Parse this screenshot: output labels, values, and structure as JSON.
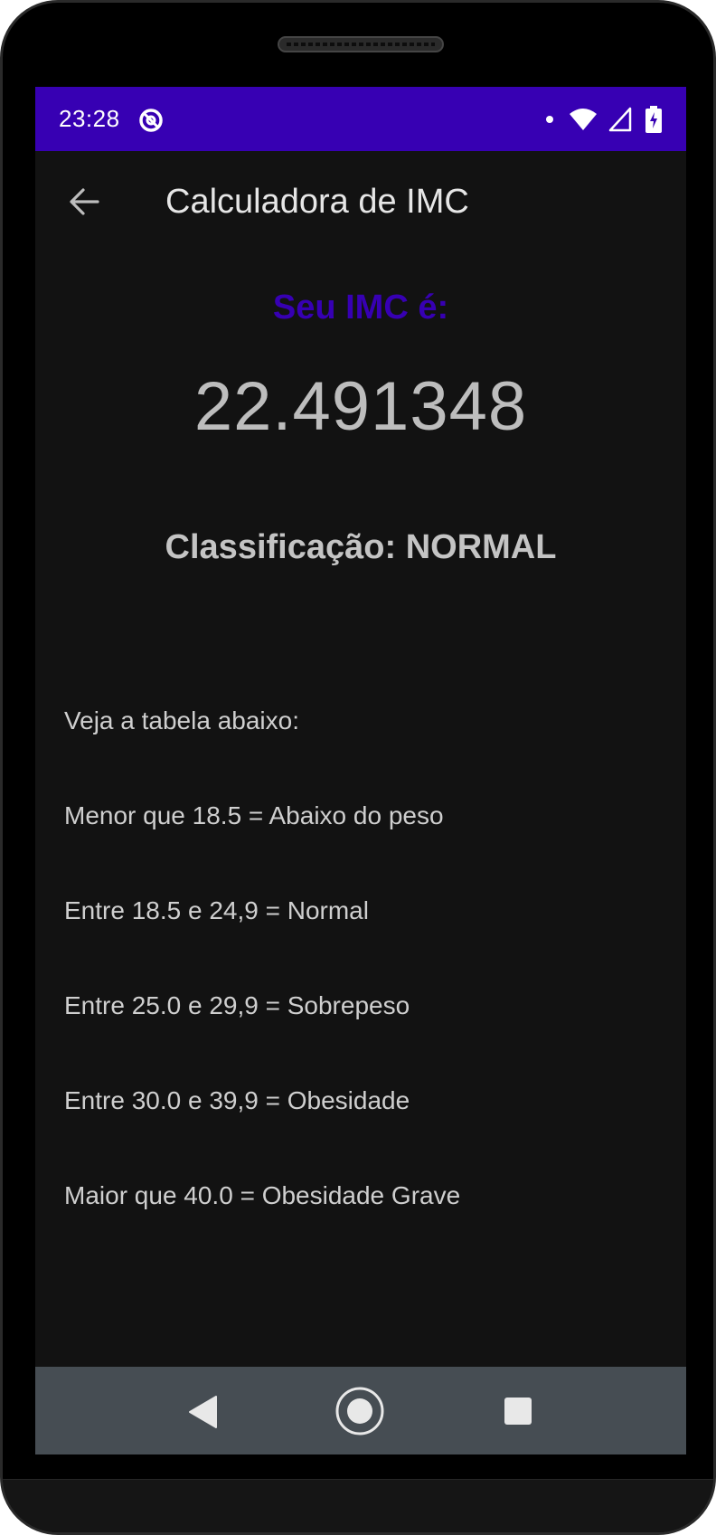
{
  "status_bar": {
    "time": "23:28",
    "icons": [
      "app-notification-icon",
      "dot-icon",
      "wifi-icon",
      "cell-signal-icon",
      "battery-charging-icon"
    ]
  },
  "app_bar": {
    "title": "Calculadora de IMC",
    "back_icon": "back-arrow-icon"
  },
  "result": {
    "label": "Seu IMC é:",
    "value": "22.491348",
    "classification_prefix": "Classificação:",
    "classification_value": "NORMAL"
  },
  "table": {
    "intro": "Veja a tabela abaixo:",
    "rows": [
      "Menor que 18.5 = Abaixo do peso",
      "Entre 18.5 e 24,9 = Normal",
      "Entre 25.0 e 29,9 = Sobrepeso",
      "Entre 30.0 e 39,9 = Obesidade",
      "Maior que 40.0 = Obesidade Grave"
    ]
  },
  "nav_bar": {
    "icons": [
      "nav-back-icon",
      "nav-home-icon",
      "nav-recents-icon"
    ]
  },
  "colors": {
    "status_bar": "#3700b3",
    "accent_label": "#3700b3",
    "background": "#121212",
    "nav_bar": "#464d53"
  }
}
